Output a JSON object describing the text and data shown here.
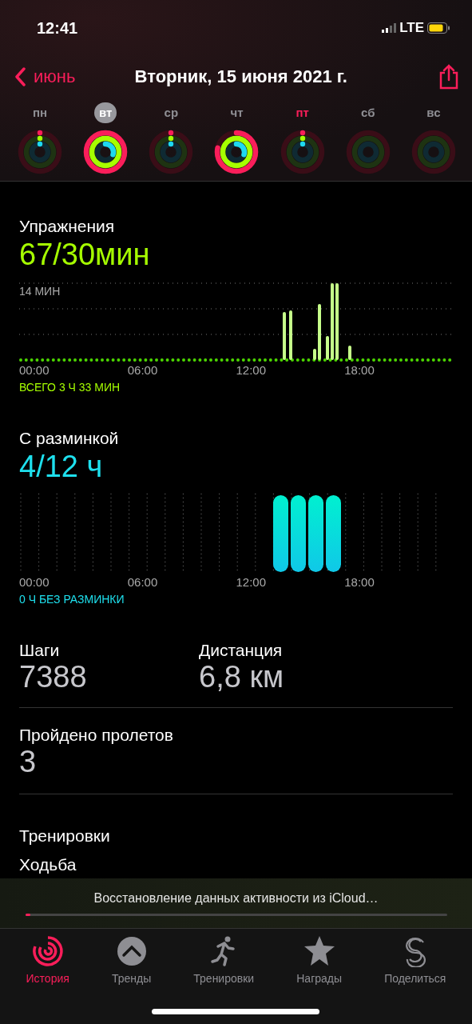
{
  "status_bar": {
    "time": "12:41",
    "network": "LTE"
  },
  "nav": {
    "back": "июнь",
    "title": "Вторник, 15 июня 2021 г."
  },
  "days": [
    {
      "label": "пн",
      "selected": false,
      "today": false,
      "rings": [
        {
          "kind": "move",
          "empty": true,
          "closed": false
        },
        {
          "kind": "exercise",
          "empty": true,
          "closed": false
        },
        {
          "kind": "stand",
          "empty": true,
          "closed": false
        }
      ]
    },
    {
      "label": "вт",
      "selected": true,
      "today": false,
      "rings": [
        {
          "kind": "move",
          "empty": false,
          "closed": true
        },
        {
          "kind": "exercise",
          "empty": false,
          "closed": true
        },
        {
          "kind": "stand",
          "empty": false,
          "closed": false
        }
      ]
    },
    {
      "label": "ср",
      "selected": false,
      "today": false,
      "rings": [
        {
          "kind": "move",
          "empty": true,
          "closed": false
        },
        {
          "kind": "exercise",
          "empty": true,
          "closed": false
        },
        {
          "kind": "stand",
          "empty": true,
          "closed": false
        }
      ]
    },
    {
      "label": "чт",
      "selected": false,
      "today": false,
      "rings": [
        {
          "kind": "move",
          "empty": false,
          "closed": false
        },
        {
          "kind": "exercise",
          "empty": false,
          "closed": true
        },
        {
          "kind": "stand",
          "empty": false,
          "closed": false
        }
      ]
    },
    {
      "label": "пт",
      "selected": false,
      "today": true,
      "rings": [
        {
          "kind": "move",
          "empty": true,
          "closed": false
        },
        {
          "kind": "exercise",
          "empty": true,
          "closed": false
        },
        {
          "kind": "stand",
          "empty": true,
          "closed": false
        }
      ]
    },
    {
      "label": "сб",
      "selected": false,
      "today": false
    },
    {
      "label": "вс",
      "selected": false,
      "today": false
    }
  ],
  "exercise": {
    "title": "Упражнения",
    "value": "67/30мин",
    "y_label": "14 МИН",
    "x_labels": [
      "00:00",
      "06:00",
      "12:00",
      "18:00"
    ],
    "total": "ВСЕГО 3 Ч 33 МИН"
  },
  "stand": {
    "title": "С разминкой",
    "value": "4/12 ч",
    "x_labels": [
      "00:00",
      "06:00",
      "12:00",
      "18:00"
    ],
    "total": "0 Ч БЕЗ РАЗМИНКИ"
  },
  "stats": [
    {
      "label": "Шаги",
      "value": "7388"
    },
    {
      "label": "Дистанция",
      "value": "6,8 км"
    }
  ],
  "flights": {
    "label": "Пройдено пролетов",
    "value": "3"
  },
  "workouts": {
    "title": "Тренировки",
    "items": [
      "Ходьба"
    ]
  },
  "banner": {
    "text": "Восстановление данных активности из iCloud…",
    "level": 0.01
  },
  "tabs": [
    {
      "label": "История",
      "selected": true,
      "kind": "history"
    },
    {
      "label": "Тренды",
      "selected": false,
      "kind": "trends"
    },
    {
      "label": "Тренировки",
      "selected": false,
      "kind": "workouts"
    },
    {
      "label": "Награды",
      "selected": false,
      "kind": "awards"
    },
    {
      "label": "Поделиться",
      "selected": false,
      "kind": "share"
    }
  ]
}
